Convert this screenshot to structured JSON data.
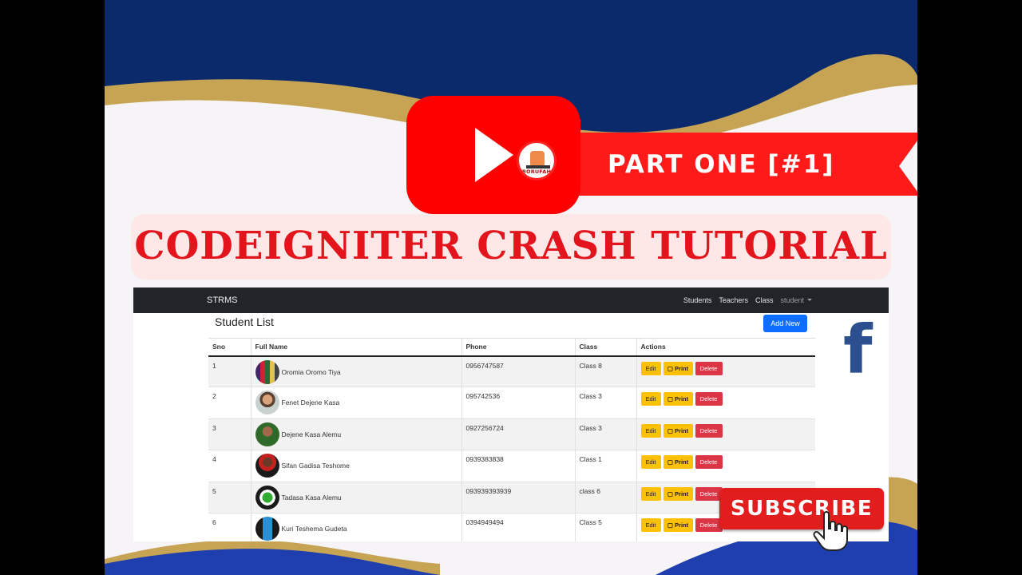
{
  "banner": {
    "part_label": "PART ONE [#1]",
    "title": "CODEIGNITER CRASH TUTORIAL",
    "channel_badge": "BORUFAH",
    "subscribe_label": "SUBSCRIBE",
    "icons": [
      "play-icon",
      "facebook-icon",
      "hand-cursor-icon"
    ],
    "colors": {
      "navy": "#0a2a6c",
      "gold": "#c7a354",
      "red": "#ff1a1a",
      "title_red": "#e3141b"
    }
  },
  "app": {
    "brand": "STRMS",
    "nav": [
      "Students",
      "Teachers",
      "Class"
    ],
    "nav_user": "student",
    "page_title": "Student List",
    "add_button": "Add New",
    "columns": [
      "Sno",
      "Full Name",
      "Phone",
      "Class",
      "Actions"
    ],
    "action_labels": {
      "edit": "Edit",
      "print": "▢ Print",
      "delete": "Delete"
    },
    "rows": [
      {
        "sno": "1",
        "name": "Oromia Oromo Tiya",
        "phone": "0956747587",
        "class": "Class 8"
      },
      {
        "sno": "2",
        "name": "Fenet Dejene Kasa",
        "phone": "095742536",
        "class": "Class 3"
      },
      {
        "sno": "3",
        "name": "Dejene Kasa Alemu",
        "phone": "0927256724",
        "class": "Class 3"
      },
      {
        "sno": "4",
        "name": "Sifan Gadisa Teshome",
        "phone": "0939383838",
        "class": "Class 1"
      },
      {
        "sno": "5",
        "name": "Tadasa Kasa Alemu",
        "phone": "093939393939",
        "class": "class 6"
      },
      {
        "sno": "6",
        "name": "Kuri Teshema Gudeta",
        "phone": "0394949494",
        "class": "Class 5"
      }
    ]
  }
}
